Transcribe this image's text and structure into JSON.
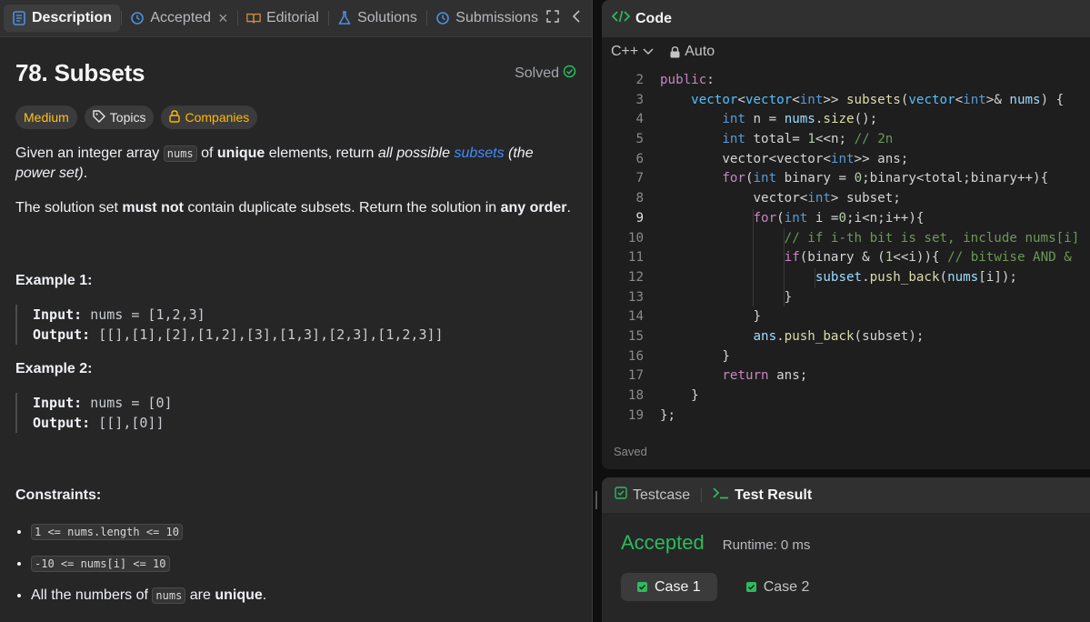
{
  "left_tabs": {
    "description": "Description",
    "accepted": "Accepted",
    "editorial": "Editorial",
    "solutions": "Solutions",
    "submissions": "Submissions"
  },
  "problem": {
    "title": "78. Subsets",
    "status": "Solved",
    "tags": {
      "difficulty": "Medium",
      "topics": "Topics",
      "companies": "Companies"
    },
    "para1": {
      "t1": "Given an integer array ",
      "code": "nums",
      "t2": " of ",
      "bold": "unique",
      "t3": " elements, return ",
      "ital": "all possible",
      "link": "subsets",
      "ital2": " (the power set)",
      "t4": "."
    },
    "para2": {
      "t1": "The solution set ",
      "bold1": "must not",
      "t2": " contain duplicate subsets. Return the solution in ",
      "bold2": "any order",
      "t3": "."
    },
    "example1": {
      "title": "Example 1:",
      "input_label": "Input:",
      "input": " nums = [1,2,3]",
      "output_label": "Output:",
      "output": " [[],[1],[2],[1,2],[3],[1,3],[2,3],[1,2,3]]"
    },
    "example2": {
      "title": "Example 2:",
      "input_label": "Input:",
      "input": " nums = [0]",
      "output_label": "Output:",
      "output": " [[],[0]]"
    },
    "constraints_title": "Constraints:",
    "constraints": {
      "c1": "1 <= nums.length <= 10",
      "c2": "-10 <= nums[i] <= 10",
      "c3_pre": "All the numbers of ",
      "c3_code": "nums",
      "c3_mid": " are ",
      "c3_bold": "unique",
      "c3_post": "."
    }
  },
  "code": {
    "header": "Code",
    "language": "C++",
    "mode": "Auto",
    "saved": "Saved",
    "line_numbers": [
      "2",
      "3",
      "4",
      "5",
      "6",
      "7",
      "8",
      "9",
      "10",
      "11",
      "12",
      "13",
      "14",
      "15",
      "16",
      "17",
      "18",
      "19"
    ]
  },
  "test": {
    "tab_testcase": "Testcase",
    "tab_result": "Test Result",
    "status": "Accepted",
    "runtime": "Runtime: 0 ms",
    "case1": "Case 1",
    "case2": "Case 2"
  },
  "colors": {
    "accepted": "#2cbb5d",
    "medium": "#ffc01e",
    "link": "#3d8cff"
  }
}
